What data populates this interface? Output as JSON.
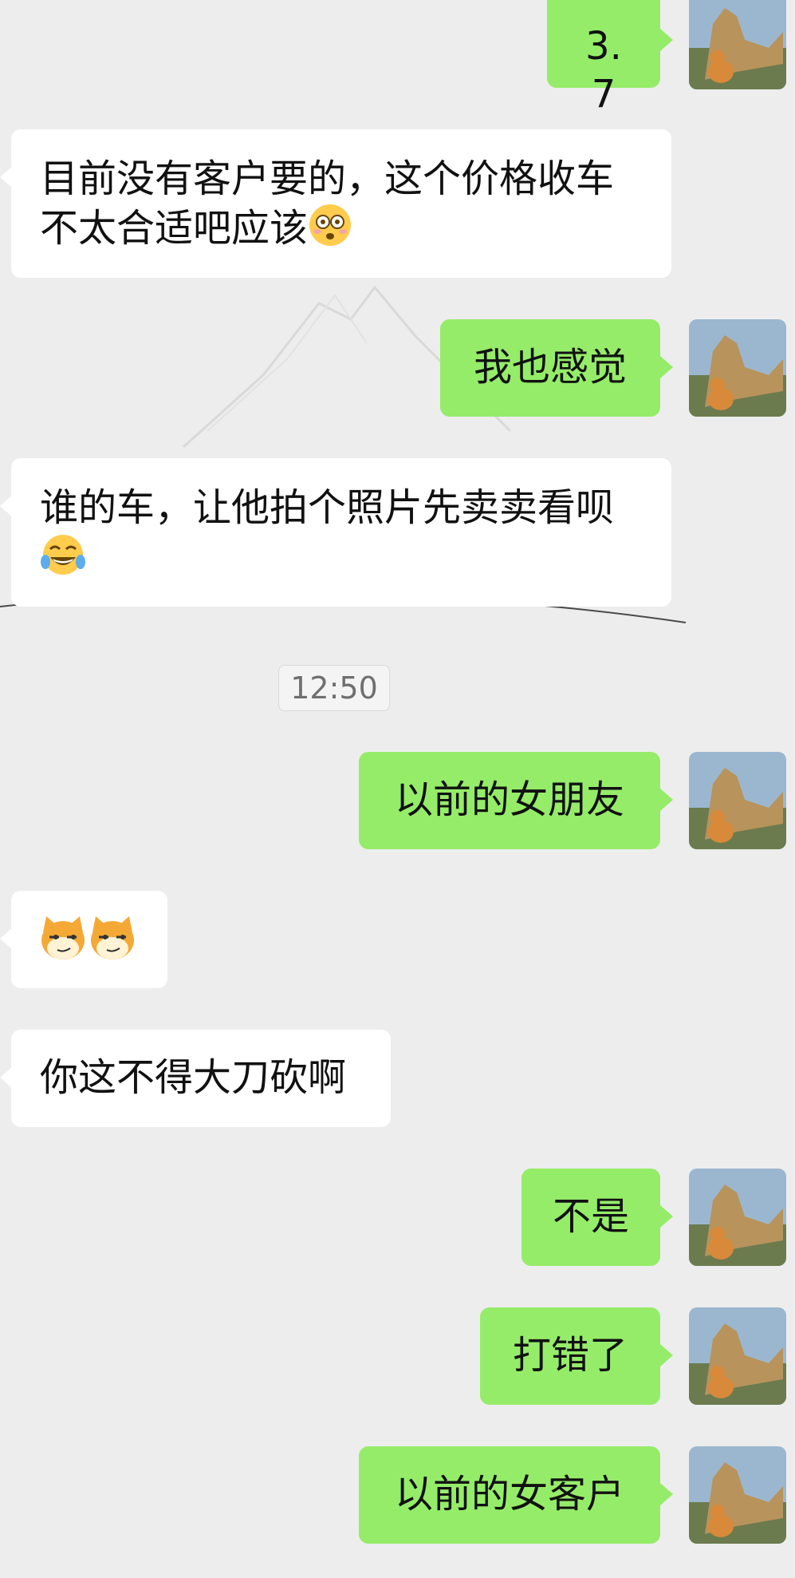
{
  "messages": [
    {
      "id": "m1",
      "side": "out",
      "text": "3.7"
    },
    {
      "id": "m2",
      "side": "in",
      "line1": "目前没有客户要的，这个价格收车",
      "line2": "不太合适吧应该",
      "emoji": "flushed-face"
    },
    {
      "id": "m3",
      "side": "out",
      "text": "我也感觉"
    },
    {
      "id": "m4",
      "side": "in",
      "line1": "谁的车，让他拍个照片先卖卖看呗",
      "emoji": "tears-of-joy-face"
    },
    {
      "id": "m5",
      "side": "out",
      "text": "以前的女朋友"
    },
    {
      "id": "m6",
      "side": "in",
      "emoji": "smirking-cat-face"
    },
    {
      "id": "m7",
      "side": "in",
      "text": "你这不得大刀砍啊"
    },
    {
      "id": "m8",
      "side": "out",
      "text": "不是"
    },
    {
      "id": "m9",
      "side": "out",
      "text": "打错了"
    },
    {
      "id": "m10",
      "side": "out",
      "text": "以前的女客户"
    }
  ],
  "timestamp": "12:50",
  "colors": {
    "background": "#ededed",
    "incoming_bubble": "#ffffff",
    "outgoing_bubble": "#95ec69",
    "text": "#111111"
  },
  "icons": {
    "avatar": "cat-with-dragon-statue-photo"
  }
}
